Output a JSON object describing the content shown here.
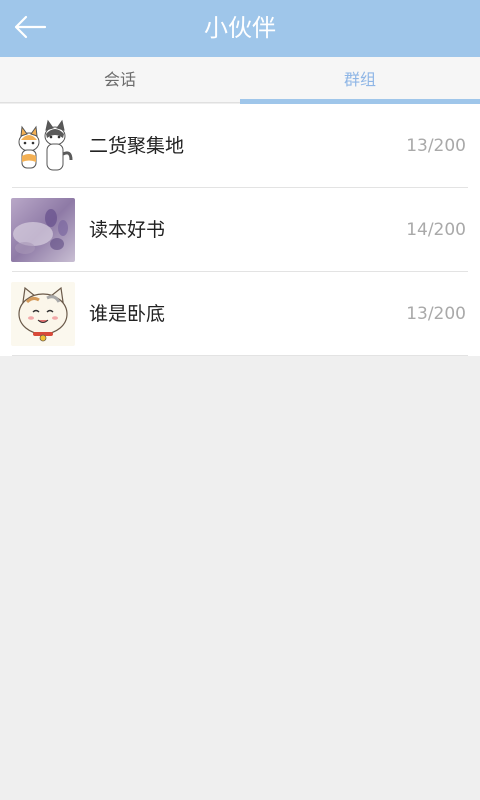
{
  "header": {
    "title": "小伙伴",
    "back_icon": "back-arrow-icon"
  },
  "tabs": [
    {
      "label": "会话",
      "active": false
    },
    {
      "label": "群组",
      "active": true
    }
  ],
  "colors": {
    "header_bg": "#9fc6ea",
    "active_tab": "#8fb6e6"
  },
  "groups": [
    {
      "name": "二货聚集地",
      "count": "13/200",
      "avatar": "two-cats-avatar"
    },
    {
      "name": "读本好书",
      "count": "14/200",
      "avatar": "purple-flower-avatar"
    },
    {
      "name": "谁是卧底",
      "count": "13/200",
      "avatar": "cartoon-cat-avatar"
    }
  ]
}
